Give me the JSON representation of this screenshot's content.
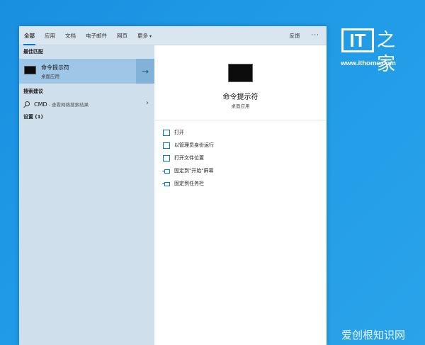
{
  "tabs": [
    {
      "label": "全部"
    },
    {
      "label": "应用"
    },
    {
      "label": "文档"
    },
    {
      "label": "电子邮件"
    },
    {
      "label": "网页"
    },
    {
      "label": "更多"
    }
  ],
  "feedback_label": "反馈",
  "more_options": "···",
  "left": {
    "best_match_header": "最佳匹配",
    "best_match": {
      "title": "命令提示符",
      "subtitle": "桌面应用"
    },
    "suggest_header": "搜索建议",
    "suggestion": {
      "query": "CMD",
      "hint": " - 查看网络搜索结果"
    },
    "settings_header": "设置 (1)"
  },
  "right": {
    "title": "命令提示符",
    "subtitle": "桌面应用",
    "actions": [
      {
        "label": "打开"
      },
      {
        "label": "以管理员身份运行"
      },
      {
        "label": "打开文件位置"
      },
      {
        "label": "固定到\"开始\"屏幕"
      },
      {
        "label": "固定到任务栏"
      }
    ]
  },
  "watermark": {
    "brand_it": "IT",
    "brand_home": "之家",
    "url": "www.ithome.com",
    "bottom": "爱创根知识网"
  },
  "colors": {
    "accent": "#0078d7",
    "desktop": "#1f9ae6",
    "selection": "#9ec6e6"
  }
}
